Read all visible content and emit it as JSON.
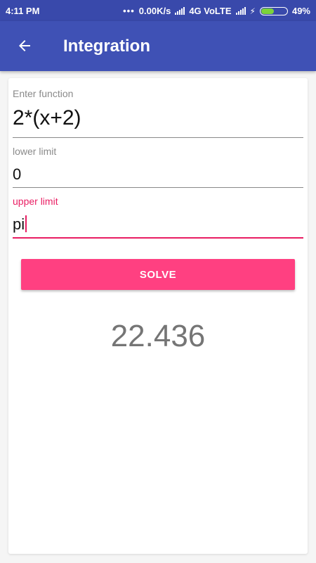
{
  "status_bar": {
    "time": "4:11 PM",
    "dots": "•••",
    "speed": "0.00K/s",
    "network": "4G VoLTE",
    "battery_percent_text": "49%",
    "battery_level": 0.49
  },
  "app_bar": {
    "back_icon": "arrow-left-icon",
    "title": "Integration"
  },
  "form": {
    "function": {
      "label": "Enter function",
      "value": "2*(x+2)"
    },
    "lower_limit": {
      "label": "lower limit",
      "value": "0"
    },
    "upper_limit": {
      "label": "upper limit",
      "value": "pi"
    }
  },
  "solve_button": {
    "label": "SOLVE"
  },
  "result": "22.436",
  "colors": {
    "primary": "#3f51b5",
    "primary_dark": "#3949ab",
    "accent": "#ff4081",
    "focus": "#e91e63",
    "result_text": "#757575"
  }
}
